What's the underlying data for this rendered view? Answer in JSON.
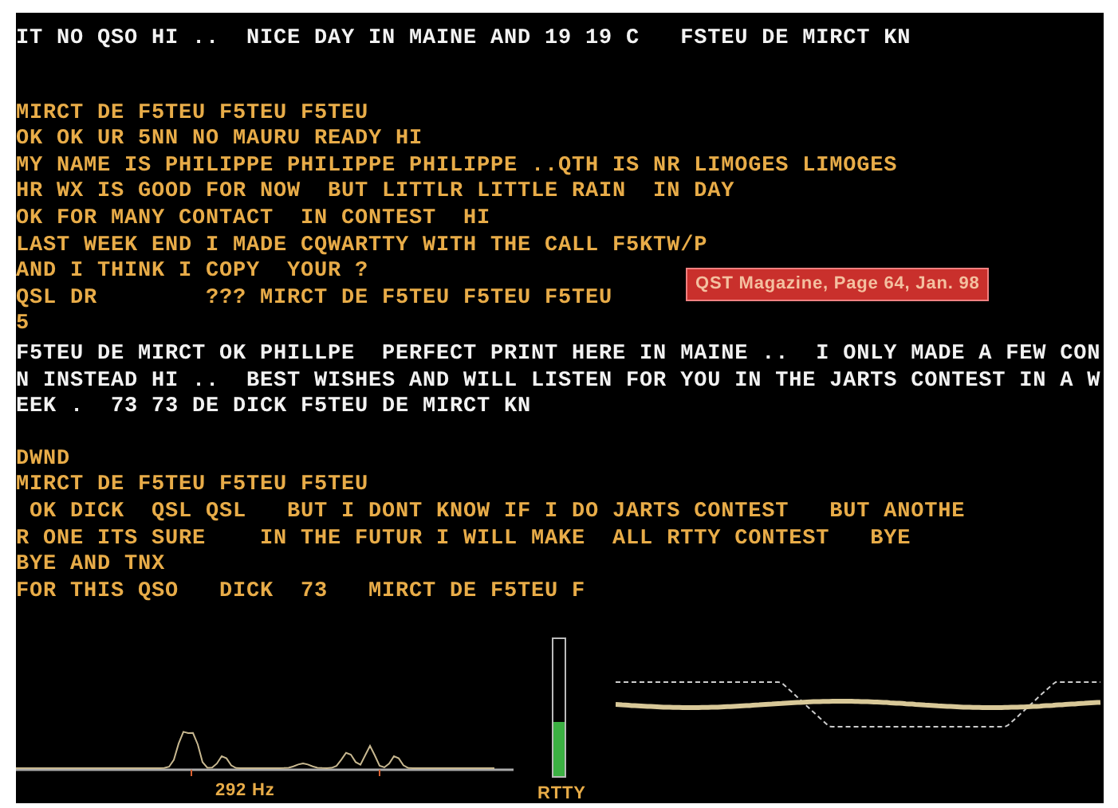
{
  "terminal": {
    "blocks": [
      {
        "kind": "rx",
        "lines": [
          "IT NO QSO HI ..  NICE DAY IN MAINE AND 19 19 C   FSTEU DE MIRCT KN"
        ]
      },
      {
        "kind": "tx",
        "lines": [
          "MIRCT DE F5TEU F5TEU F5TEU",
          "OK OK UR 5NN NO MAURU READY HI",
          "MY NAME IS PHILIPPE PHILIPPE PHILIPPE ..QTH IS NR LIMOGES LIMOGES",
          "HR WX IS GOOD FOR NOW  BUT LITTLR LITTLE RAIN  IN DAY",
          "OK FOR MANY CONTACT  IN CONTEST  HI",
          "LAST WEEK END I MADE CQWARTTY WITH THE CALL F5KTW/P",
          "AND I THINK I COPY  YOUR ?",
          "QSL DR        ??? MIRCT DE F5TEU F5TEU F5TEU",
          "5"
        ]
      },
      {
        "kind": "rx",
        "lines": [
          "F5TEU DE MIRCT OK PHILLPE  PERFECT PRINT HERE IN MAINE ..  I ONLY MADE A FEW CON",
          "N INSTEAD HI ..  BEST WISHES AND WILL LISTEN FOR YOU IN THE JARTS CONTEST IN A W",
          "EEK .  73 73 DE DICK F5TEU DE MIRCT KN"
        ]
      },
      {
        "kind": "tx",
        "lines": [
          "DWND",
          "MIRCT DE F5TEU F5TEU F5TEU",
          " OK DICK  QSL QSL   BUT I DONT KNOW IF I DO JARTS CONTEST   BUT ANOTHE",
          "R ONE ITS SURE    IN THE FUTUR I WILL MAKE  ALL RTTY CONTEST   BYE",
          "BYE AND TNX",
          "FOR THIS QSO   DICK  73   MIRCT DE F5TEU F"
        ]
      }
    ]
  },
  "credit_label": "QST Magazine, Page 64, Jan. 98",
  "spectrum": {
    "frequency": "292 Hz"
  },
  "tuning_meter": {
    "level": 0.4,
    "label": "RTTY"
  }
}
